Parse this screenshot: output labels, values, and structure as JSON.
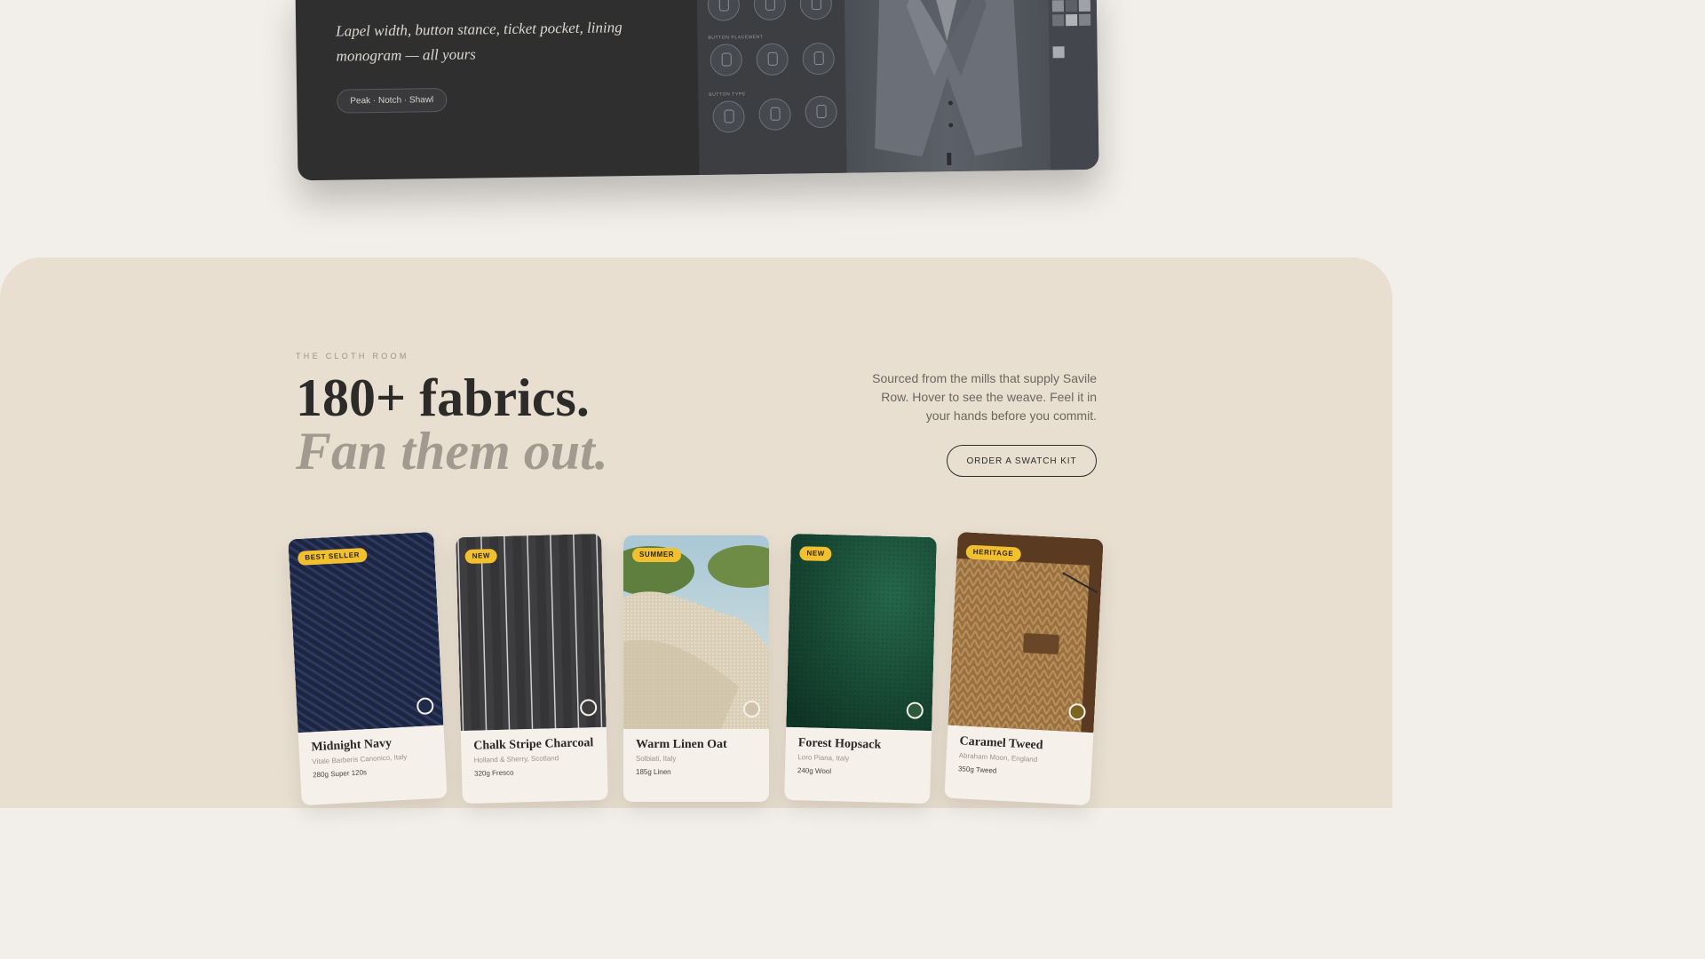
{
  "configurator": {
    "tagline": "Lapel width, button stance, ticket pocket, lining monogram — all yours",
    "lapel_pill": "Peak · Notch · Shawl",
    "panel": {
      "button_placement_label": "BUTTON PLACEMENT",
      "button_type_label": "BUTTON TYPE"
    }
  },
  "cloth_room": {
    "eyebrow": "THE CLOTH ROOM",
    "headline": "180+ fabrics.",
    "headline_em": "Fan them out.",
    "intro": "Sourced from the mills that supply Savile Row. Hover to see the weave. Feel it in your hands before you commit.",
    "cta": "ORDER A SWATCH KIT"
  },
  "fabrics": [
    {
      "name": "Midnight Navy",
      "mill": "Vitale Barberis Canonico, Italy",
      "weight": "280g Super 120s",
      "badge": "BEST SELLER",
      "swatch": "#1f2b49"
    },
    {
      "name": "Chalk Stripe Charcoal",
      "mill": "Holland & Sherry, Scotland",
      "weight": "320g Fresco",
      "badge": "NEW",
      "swatch": "#3c3c3e"
    },
    {
      "name": "Warm Linen Oat",
      "mill": "Solbiati, Italy",
      "weight": "185g Linen",
      "badge": "SUMMER",
      "swatch": "#cfc3ab"
    },
    {
      "name": "Forest Hopsack",
      "mill": "Loro Piana, Italy",
      "weight": "240g Wool",
      "badge": "NEW",
      "swatch": "#2d5a3a"
    },
    {
      "name": "Caramel Tweed",
      "mill": "Abraham Moon, England",
      "weight": "350g Tweed",
      "badge": "HERITAGE",
      "swatch": "#7d6420"
    }
  ]
}
